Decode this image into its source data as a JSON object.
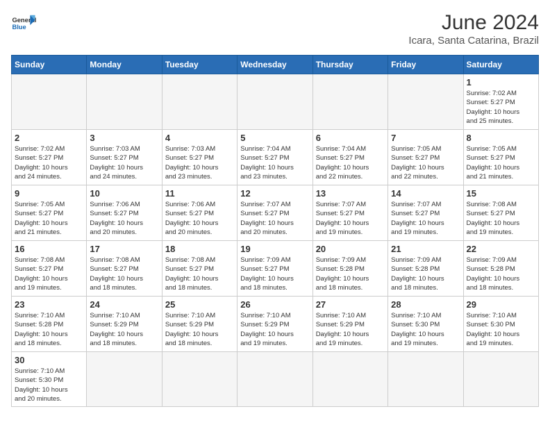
{
  "logo": {
    "general": "General",
    "blue": "Blue"
  },
  "header": {
    "month": "June 2024",
    "location": "Icara, Santa Catarina, Brazil"
  },
  "weekdays": [
    "Sunday",
    "Monday",
    "Tuesday",
    "Wednesday",
    "Thursday",
    "Friday",
    "Saturday"
  ],
  "weeks": [
    [
      {
        "day": "",
        "empty": true
      },
      {
        "day": "",
        "empty": true
      },
      {
        "day": "",
        "empty": true
      },
      {
        "day": "",
        "empty": true
      },
      {
        "day": "",
        "empty": true
      },
      {
        "day": "",
        "empty": true
      },
      {
        "day": "1",
        "sunrise": "7:02 AM",
        "sunset": "5:27 PM",
        "daylight": "10 hours and 25 minutes."
      }
    ],
    [
      {
        "day": "2",
        "sunrise": "7:02 AM",
        "sunset": "5:27 PM",
        "daylight": "10 hours and 24 minutes."
      },
      {
        "day": "3",
        "sunrise": "7:03 AM",
        "sunset": "5:27 PM",
        "daylight": "10 hours and 24 minutes."
      },
      {
        "day": "4",
        "sunrise": "7:03 AM",
        "sunset": "5:27 PM",
        "daylight": "10 hours and 23 minutes."
      },
      {
        "day": "5",
        "sunrise": "7:04 AM",
        "sunset": "5:27 PM",
        "daylight": "10 hours and 23 minutes."
      },
      {
        "day": "6",
        "sunrise": "7:04 AM",
        "sunset": "5:27 PM",
        "daylight": "10 hours and 22 minutes."
      },
      {
        "day": "7",
        "sunrise": "7:05 AM",
        "sunset": "5:27 PM",
        "daylight": "10 hours and 22 minutes."
      },
      {
        "day": "8",
        "sunrise": "7:05 AM",
        "sunset": "5:27 PM",
        "daylight": "10 hours and 21 minutes."
      }
    ],
    [
      {
        "day": "9",
        "sunrise": "7:05 AM",
        "sunset": "5:27 PM",
        "daylight": "10 hours and 21 minutes."
      },
      {
        "day": "10",
        "sunrise": "7:06 AM",
        "sunset": "5:27 PM",
        "daylight": "10 hours and 20 minutes."
      },
      {
        "day": "11",
        "sunrise": "7:06 AM",
        "sunset": "5:27 PM",
        "daylight": "10 hours and 20 minutes."
      },
      {
        "day": "12",
        "sunrise": "7:07 AM",
        "sunset": "5:27 PM",
        "daylight": "10 hours and 20 minutes."
      },
      {
        "day": "13",
        "sunrise": "7:07 AM",
        "sunset": "5:27 PM",
        "daylight": "10 hours and 19 minutes."
      },
      {
        "day": "14",
        "sunrise": "7:07 AM",
        "sunset": "5:27 PM",
        "daylight": "10 hours and 19 minutes."
      },
      {
        "day": "15",
        "sunrise": "7:08 AM",
        "sunset": "5:27 PM",
        "daylight": "10 hours and 19 minutes."
      }
    ],
    [
      {
        "day": "16",
        "sunrise": "7:08 AM",
        "sunset": "5:27 PM",
        "daylight": "10 hours and 19 minutes."
      },
      {
        "day": "17",
        "sunrise": "7:08 AM",
        "sunset": "5:27 PM",
        "daylight": "10 hours and 18 minutes."
      },
      {
        "day": "18",
        "sunrise": "7:08 AM",
        "sunset": "5:27 PM",
        "daylight": "10 hours and 18 minutes."
      },
      {
        "day": "19",
        "sunrise": "7:09 AM",
        "sunset": "5:27 PM",
        "daylight": "10 hours and 18 minutes."
      },
      {
        "day": "20",
        "sunrise": "7:09 AM",
        "sunset": "5:28 PM",
        "daylight": "10 hours and 18 minutes."
      },
      {
        "day": "21",
        "sunrise": "7:09 AM",
        "sunset": "5:28 PM",
        "daylight": "10 hours and 18 minutes."
      },
      {
        "day": "22",
        "sunrise": "7:09 AM",
        "sunset": "5:28 PM",
        "daylight": "10 hours and 18 minutes."
      }
    ],
    [
      {
        "day": "23",
        "sunrise": "7:10 AM",
        "sunset": "5:28 PM",
        "daylight": "10 hours and 18 minutes."
      },
      {
        "day": "24",
        "sunrise": "7:10 AM",
        "sunset": "5:29 PM",
        "daylight": "10 hours and 18 minutes."
      },
      {
        "day": "25",
        "sunrise": "7:10 AM",
        "sunset": "5:29 PM",
        "daylight": "10 hours and 18 minutes."
      },
      {
        "day": "26",
        "sunrise": "7:10 AM",
        "sunset": "5:29 PM",
        "daylight": "10 hours and 19 minutes."
      },
      {
        "day": "27",
        "sunrise": "7:10 AM",
        "sunset": "5:29 PM",
        "daylight": "10 hours and 19 minutes."
      },
      {
        "day": "28",
        "sunrise": "7:10 AM",
        "sunset": "5:30 PM",
        "daylight": "10 hours and 19 minutes."
      },
      {
        "day": "29",
        "sunrise": "7:10 AM",
        "sunset": "5:30 PM",
        "daylight": "10 hours and 19 minutes."
      }
    ],
    [
      {
        "day": "30",
        "sunrise": "7:10 AM",
        "sunset": "5:30 PM",
        "daylight": "10 hours and 20 minutes."
      },
      {
        "day": "",
        "empty": true
      },
      {
        "day": "",
        "empty": true
      },
      {
        "day": "",
        "empty": true
      },
      {
        "day": "",
        "empty": true
      },
      {
        "day": "",
        "empty": true
      },
      {
        "day": "",
        "empty": true
      }
    ]
  ],
  "labels": {
    "sunrise": "Sunrise:",
    "sunset": "Sunset:",
    "daylight": "Daylight:"
  }
}
